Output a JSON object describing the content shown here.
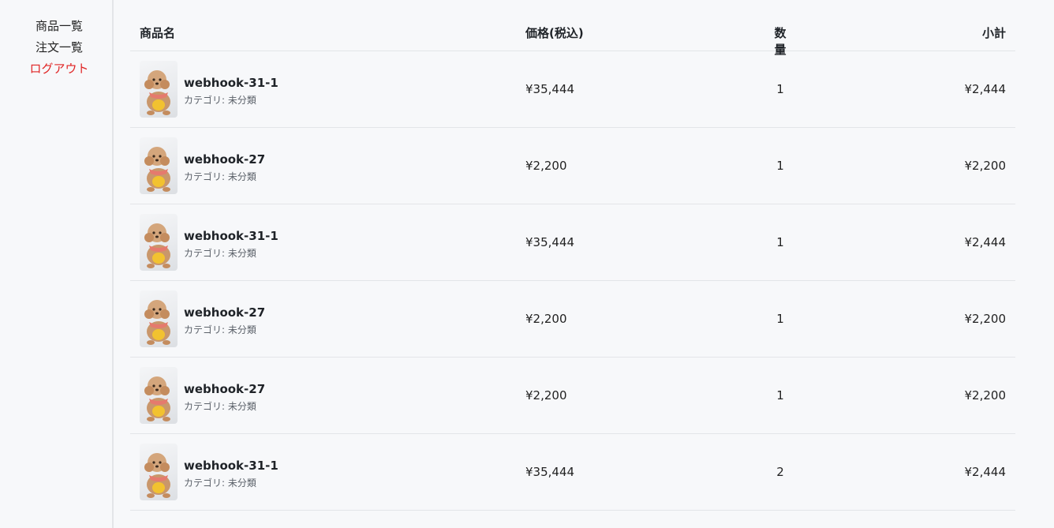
{
  "sidebar": {
    "items": [
      {
        "label": "商品一覧"
      },
      {
        "label": "注文一覧"
      },
      {
        "label": "ログアウト"
      }
    ]
  },
  "table": {
    "headers": {
      "name": "商品名",
      "price": "価格(税込)",
      "qty": "数量",
      "subtotal": "小計"
    },
    "rows": [
      {
        "name": "webhook-31-1",
        "category": "カテゴリ: 未分類",
        "price": "¥35,444",
        "qty": "1",
        "subtotal": "¥2,444"
      },
      {
        "name": "webhook-27",
        "category": "カテゴリ: 未分類",
        "price": "¥2,200",
        "qty": "1",
        "subtotal": "¥2,200"
      },
      {
        "name": "webhook-31-1",
        "category": "カテゴリ: 未分類",
        "price": "¥35,444",
        "qty": "1",
        "subtotal": "¥2,444"
      },
      {
        "name": "webhook-27",
        "category": "カテゴリ: 未分類",
        "price": "¥2,200",
        "qty": "1",
        "subtotal": "¥2,200"
      },
      {
        "name": "webhook-27",
        "category": "カテゴリ: 未分類",
        "price": "¥2,200",
        "qty": "1",
        "subtotal": "¥2,200"
      },
      {
        "name": "webhook-31-1",
        "category": "カテゴリ: 未分類",
        "price": "¥35,444",
        "qty": "2",
        "subtotal": "¥2,444"
      }
    ]
  },
  "colors": {
    "logout": "#e02424",
    "divider": "#e3e5e8",
    "background": "#f7f8fa"
  }
}
